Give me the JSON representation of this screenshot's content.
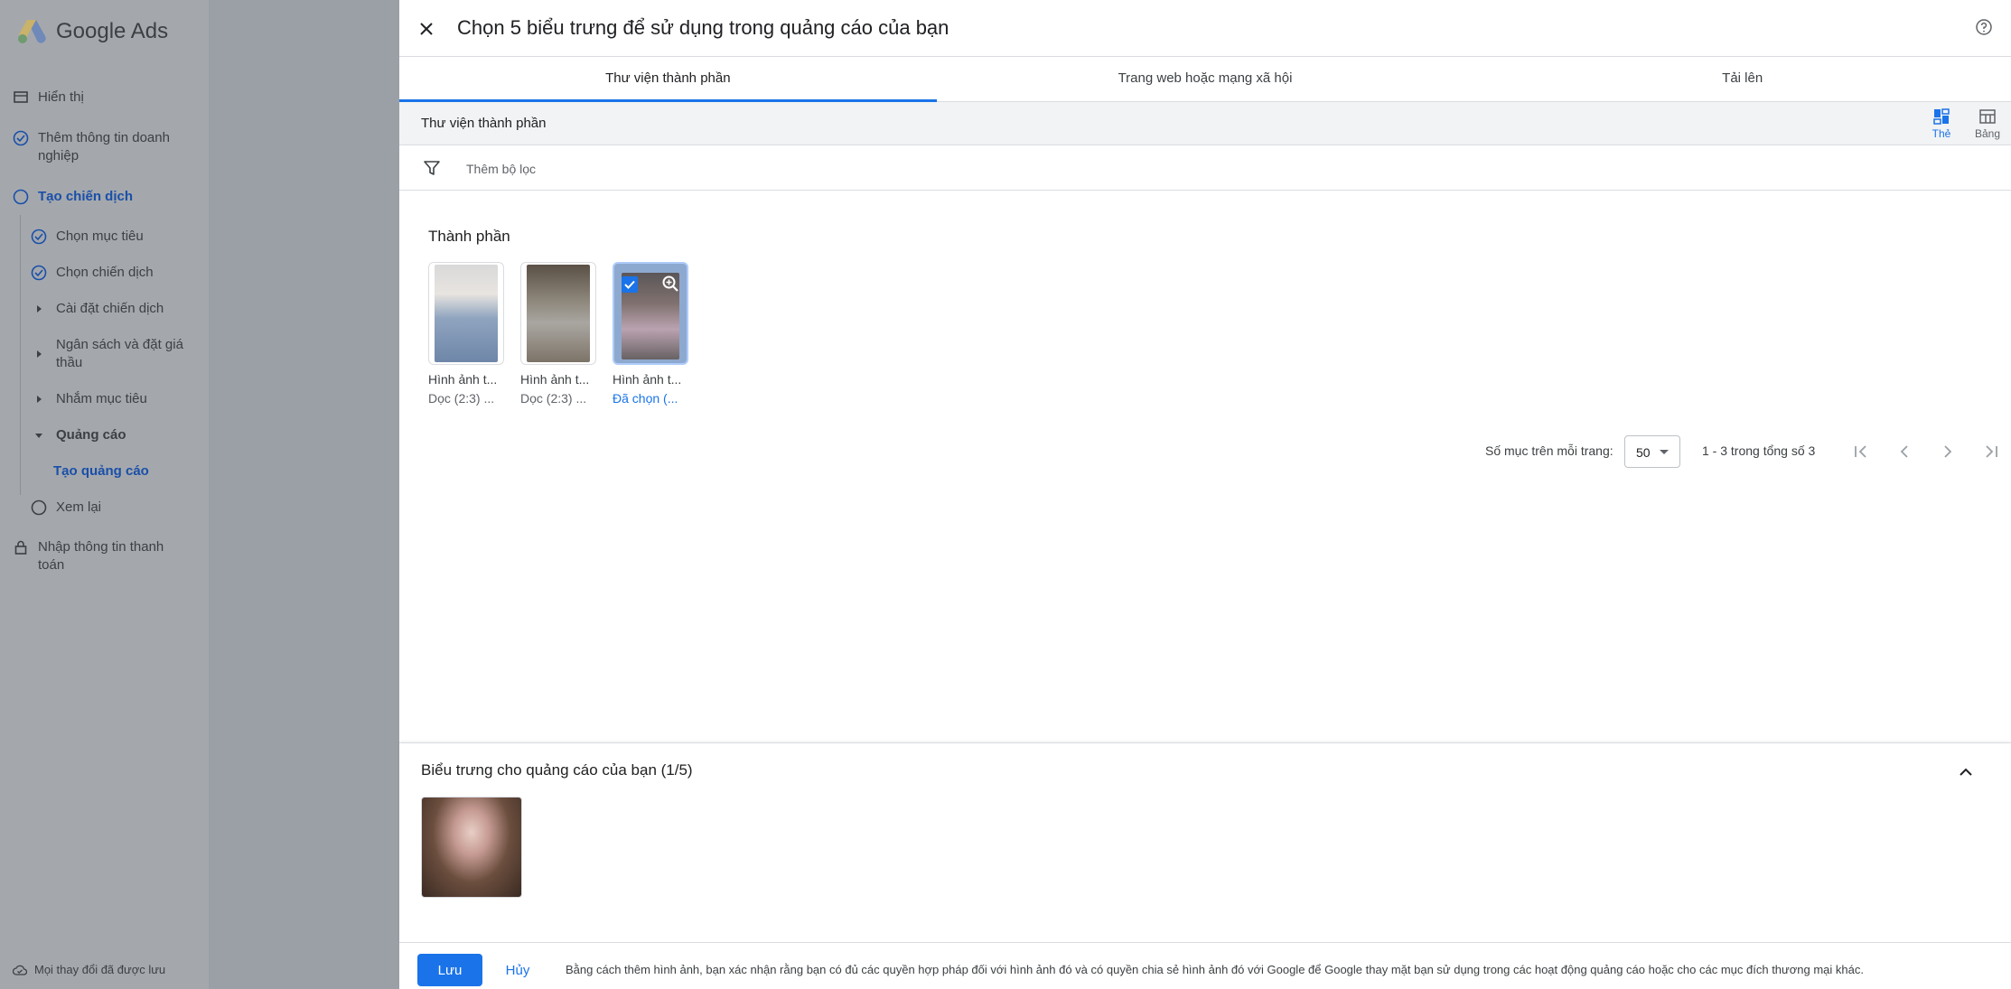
{
  "app": {
    "name": "Google Ads"
  },
  "sidebar": {
    "items": [
      {
        "label": "Hiển thị",
        "icon": "display-icon"
      },
      {
        "label": "Thêm thông tin doanh nghiệp",
        "icon": "check-circle-icon"
      },
      {
        "label": "Tạo chiến dịch",
        "icon": "circle-icon"
      },
      {
        "label": "Chọn mục tiêu",
        "icon": "check-circle-icon"
      },
      {
        "label": "Chọn chiến dịch",
        "icon": "check-circle-icon"
      },
      {
        "label": "Cài đặt chiến dịch",
        "icon": "caret-right-icon"
      },
      {
        "label": "Ngân sách và đặt giá thầu",
        "icon": "caret-right-icon"
      },
      {
        "label": "Nhắm mục tiêu",
        "icon": "caret-right-icon"
      },
      {
        "label": "Quảng cáo",
        "icon": "caret-down-icon"
      },
      {
        "label": "Tạo quảng cáo",
        "icon": ""
      },
      {
        "label": "Xem lại",
        "icon": "circle-icon"
      },
      {
        "label": "Nhập thông tin thanh toán",
        "icon": "lock-icon"
      }
    ],
    "saved_status": "Mọi thay đổi đã được lưu"
  },
  "dialog": {
    "title": "Chọn 5 biểu trưng để sử dụng trong quảng cáo của bạn",
    "tabs": [
      {
        "label": "Thư viện thành phần",
        "active": true
      },
      {
        "label": "Trang web hoặc mạng xã hội",
        "active": false
      },
      {
        "label": "Tải lên",
        "active": false
      }
    ],
    "library_label": "Thư viện thành phần",
    "views": [
      {
        "label": "Thẻ",
        "active": true
      },
      {
        "label": "Bảng",
        "active": false
      }
    ],
    "filter_placeholder": "Thêm bộ lọc",
    "section_title": "Thành phần",
    "assets": [
      {
        "name": "Hình ảnh t...",
        "meta": "Dọc (2:3) ...",
        "selected": false
      },
      {
        "name": "Hình ảnh t...",
        "meta": "Dọc (2:3) ...",
        "selected": false
      },
      {
        "name": "Hình ảnh t...",
        "meta": "Đã chọn (...",
        "selected": true
      }
    ],
    "pagination": {
      "per_page_label": "Số mục trên mỗi trang:",
      "per_page_value": "50",
      "range": "1 - 3 trong tổng số 3"
    },
    "logos_panel_title": "Biểu trưng cho quảng cáo của bạn (1/5)",
    "footer": {
      "save_label": "Lưu",
      "cancel_label": "Hủy",
      "disclaimer": "Bằng cách thêm hình ảnh, bạn xác nhận rằng bạn có đủ các quyền hợp pháp đối với hình ảnh đó và có quyền chia sẻ hình ảnh đó với Google để Google thay mặt bạn sử dụng trong các hoạt động quảng cáo hoặc cho các mục đích thương mại khác."
    }
  },
  "colors": {
    "accent": "#1a73e8",
    "sidebar_overlay": "#9aa0a6"
  }
}
